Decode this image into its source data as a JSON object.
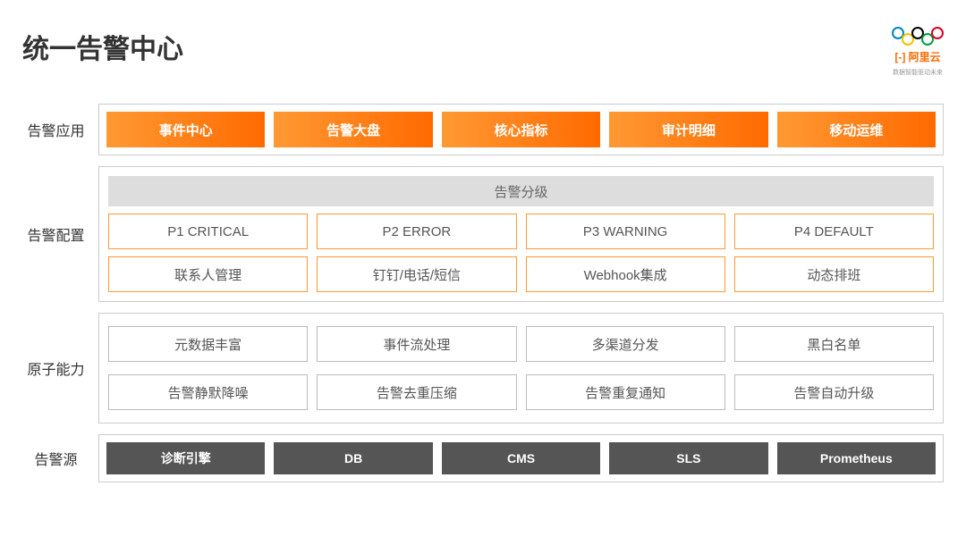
{
  "title": "统一告警中心",
  "logo": {
    "brand": "[-] 阿里云",
    "sub": "数据智能驱动未来"
  },
  "rows": {
    "app": {
      "label": "告警应用",
      "items": [
        "事件中心",
        "告警大盘",
        "核心指标",
        "审计明细",
        "移动运维"
      ]
    },
    "config": {
      "label": "告警配置",
      "header": "告警分级",
      "priority": [
        "P1 CRITICAL",
        "P2 ERROR",
        "P3 WARNING",
        "P4 DEFAULT"
      ],
      "contacts": [
        "联系人管理",
        "钉钉/电话/短信",
        "Webhook集成",
        "动态排班"
      ]
    },
    "atomic": {
      "label": "原子能力",
      "row1": [
        "元数据丰富",
        "事件流处理",
        "多渠道分发",
        "黑白名单"
      ],
      "row2": [
        "告警静默降噪",
        "告警去重压缩",
        "告警重复通知",
        "告警自动升级"
      ]
    },
    "source": {
      "label": "告警源",
      "items": [
        "诊断引擎",
        "DB",
        "CMS",
        "SLS",
        "Prometheus"
      ]
    }
  }
}
